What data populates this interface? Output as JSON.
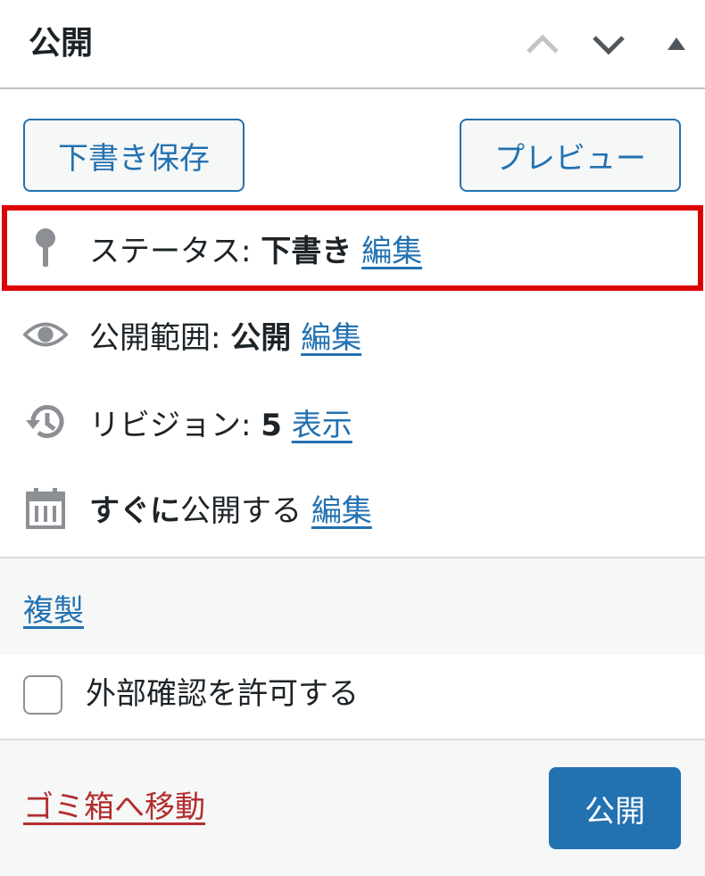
{
  "panel": {
    "title": "公開",
    "controls": [
      "move-up",
      "move-down",
      "toggle-panel"
    ]
  },
  "buttons": {
    "save_draft": "下書き保存",
    "preview": "プレビュー"
  },
  "status": {
    "label": "ステータス:",
    "value": "下書き",
    "edit": "編集"
  },
  "visibility": {
    "label": "公開範囲:",
    "value": "公開",
    "edit": "編集"
  },
  "revisions": {
    "label": "リビジョン:",
    "count": "5",
    "action": "表示"
  },
  "schedule": {
    "bold": "すぐに",
    "rest": "公開する",
    "edit": "編集"
  },
  "duplicate": "複製",
  "preview_permission": {
    "label": "外部確認を許可する",
    "checked": false
  },
  "footer": {
    "trash": "ゴミ箱へ移動",
    "publish": "公開"
  },
  "colors": {
    "accent": "#2271b1",
    "danger": "#b32d2e",
    "highlight": "#dd0000"
  }
}
